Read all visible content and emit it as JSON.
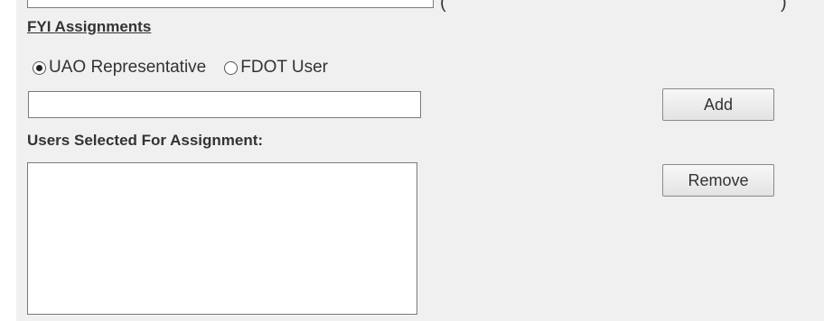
{
  "section": {
    "title": "FYI Assignments"
  },
  "assignment_type": {
    "options": [
      {
        "label": "UAO Representative",
        "selected": true
      },
      {
        "label": "FDOT User",
        "selected": false
      }
    ]
  },
  "user_input": {
    "value": "",
    "placeholder": ""
  },
  "buttons": {
    "add_label": "Add",
    "remove_label": "Remove"
  },
  "selected_users": {
    "label": "Users Selected For Assignment:",
    "items": []
  }
}
